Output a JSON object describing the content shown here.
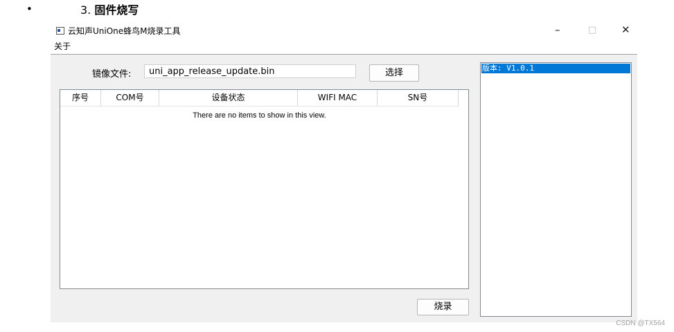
{
  "doc": {
    "bullet": "•",
    "heading_number": "3.",
    "heading_text": "固件烧写",
    "watermark": "CSDN @TX564"
  },
  "window": {
    "title": "云知声UniOne蜂鸟M烧录工具",
    "controls": {
      "minimize": "–",
      "maximize": "□",
      "close": "✕"
    },
    "menu": [
      "关于"
    ],
    "file_label": "镜像文件:",
    "file_value": "uni_app_release_update.bin",
    "select_button": "选择",
    "burn_button": "烧录",
    "table": {
      "columns": [
        "序号",
        "COM号",
        "设备状态",
        "WIFI MAC",
        "SN号"
      ],
      "rows": [],
      "empty_message": "There are no items to show in this view."
    },
    "version_list": [
      "版本: V1.0.1"
    ]
  },
  "colors": {
    "selection": "#0078d7",
    "window_bg": "#f0f0f0"
  },
  "icons": {
    "app": "app-window-icon"
  }
}
